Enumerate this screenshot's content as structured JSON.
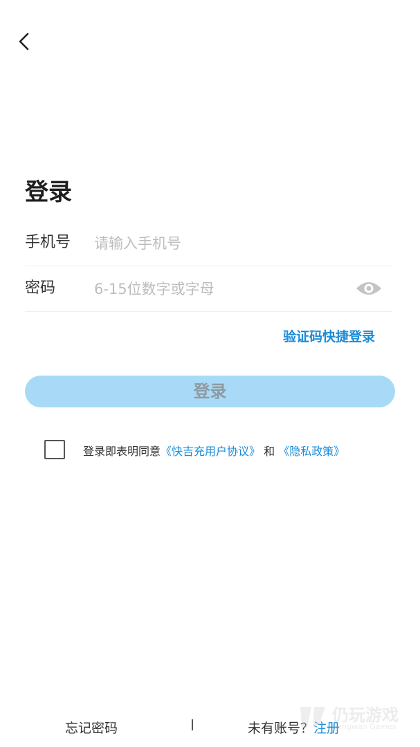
{
  "header": {
    "back_icon": "chevron-left-icon"
  },
  "page": {
    "title": "登录"
  },
  "form": {
    "phone": {
      "label": "手机号",
      "placeholder": "请输入手机号",
      "value": ""
    },
    "password": {
      "label": "密码",
      "placeholder": "6-15位数字或字母",
      "value": "",
      "toggle_icon": "eye-icon"
    },
    "quick_login_link": "验证码快捷登录",
    "submit_label": "登录"
  },
  "agreement": {
    "checked": false,
    "prefix": "登录即表明同意",
    "user_agreement": "《快吉充用户协议》",
    "joiner": "和",
    "privacy_policy": "《隐私政策》"
  },
  "footer": {
    "forgot_password": "忘记密码",
    "divider": "|",
    "no_account": "未有账号？",
    "register": "注册"
  },
  "watermark": {
    "text": "仍玩游戏",
    "subtext": "Rengwan Games"
  },
  "colors": {
    "accent": "#1a8cd8",
    "button_bg": "#a8daf7",
    "button_text": "#8f9aa2"
  }
}
